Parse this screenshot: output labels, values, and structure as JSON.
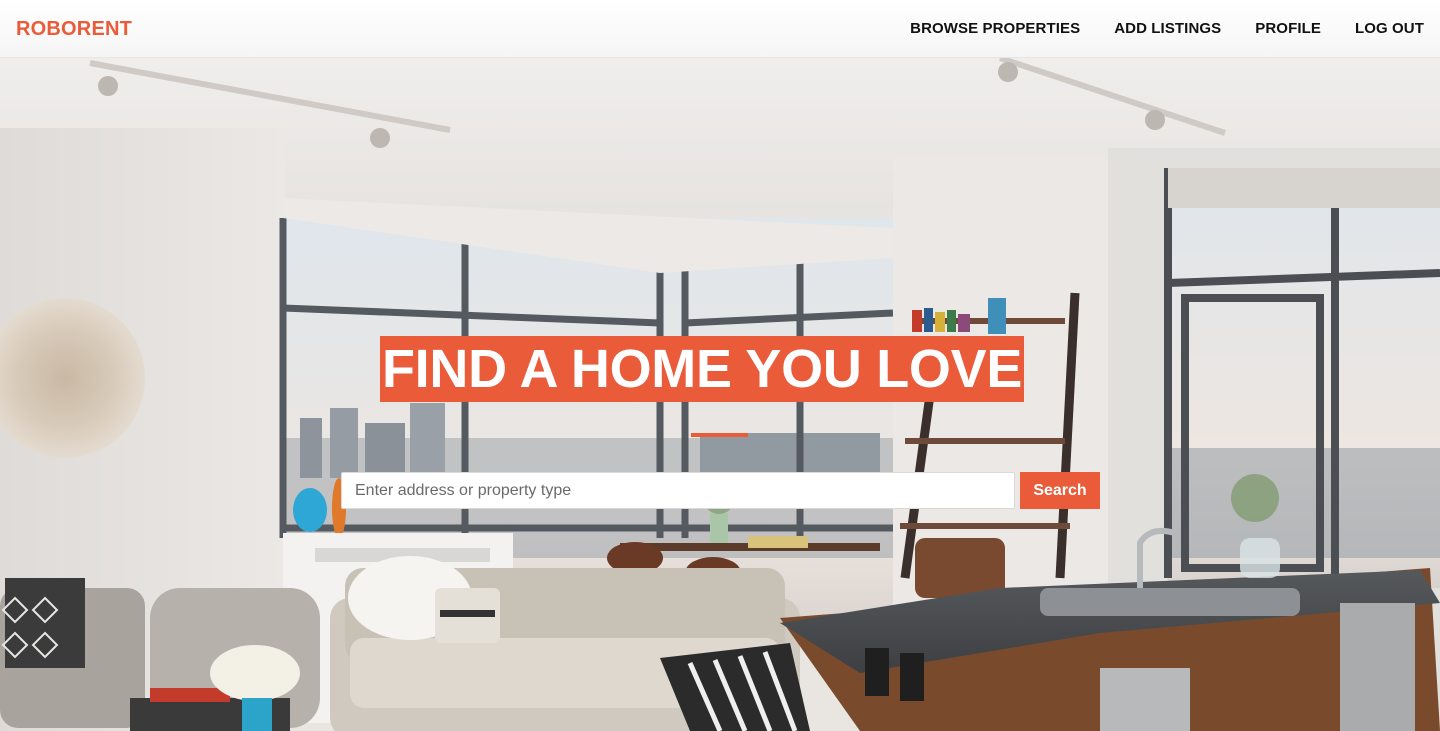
{
  "app": {
    "brand": "ROBORENT"
  },
  "nav": {
    "items": [
      {
        "label": "BROWSE PROPERTIES"
      },
      {
        "label": "ADD LISTINGS"
      },
      {
        "label": "PROFILE"
      },
      {
        "label": "LOG OUT"
      }
    ]
  },
  "hero": {
    "title": "FIND A HOME YOU LOVE",
    "background_image": "living-room-with-kitchen-and-city-view-windows",
    "search": {
      "placeholder": "Enter address or property type",
      "value": "",
      "button_label": "Search"
    }
  },
  "colors": {
    "accent": "#ea5b3a",
    "nav_text": "#111111",
    "background": "#ffffff"
  }
}
